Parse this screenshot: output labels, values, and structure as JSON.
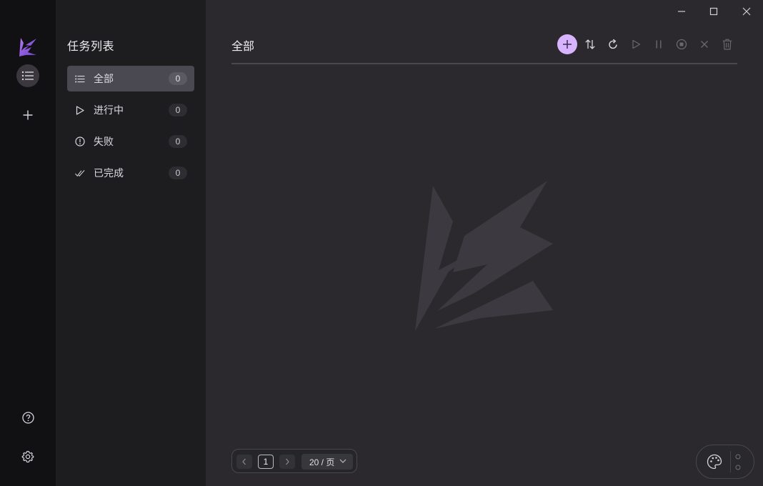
{
  "window": {
    "controls": [
      "minimize",
      "maximize",
      "close"
    ]
  },
  "rail": {
    "logo": "lightning-logo",
    "items": [
      {
        "icon": "list-icon",
        "active": true
      },
      {
        "icon": "plus-icon",
        "active": false
      }
    ],
    "bottom": [
      {
        "icon": "help-icon"
      },
      {
        "icon": "settings-icon"
      }
    ]
  },
  "panel": {
    "title": "任务列表",
    "items": [
      {
        "label": "全部",
        "count": "0",
        "icon": "list-icon",
        "active": true
      },
      {
        "label": "进行中",
        "count": "0",
        "icon": "play-outline-icon",
        "active": false
      },
      {
        "label": "失败",
        "count": "0",
        "icon": "alert-circle-icon",
        "active": false
      },
      {
        "label": "已完成",
        "count": "0",
        "icon": "double-check-icon",
        "active": false
      }
    ]
  },
  "main": {
    "title": "全部",
    "toolbar": [
      {
        "icon": "plus-icon",
        "state": "primary"
      },
      {
        "icon": "sort-icon",
        "state": "enabled"
      },
      {
        "icon": "refresh-icon",
        "state": "enabled"
      },
      {
        "icon": "play-icon",
        "state": "disabled"
      },
      {
        "icon": "pause-icon",
        "state": "disabled"
      },
      {
        "icon": "stop-icon",
        "state": "disabled"
      },
      {
        "icon": "close-icon",
        "state": "disabled"
      },
      {
        "icon": "trash-icon",
        "state": "disabled"
      }
    ]
  },
  "pagination": {
    "current_page": "1",
    "page_size": "20 / 页"
  },
  "colors": {
    "accent": "#d8b4fe",
    "rail_bg": "#111013",
    "panel_bg": "#1d1c1f",
    "main_bg": "#2b292d"
  }
}
